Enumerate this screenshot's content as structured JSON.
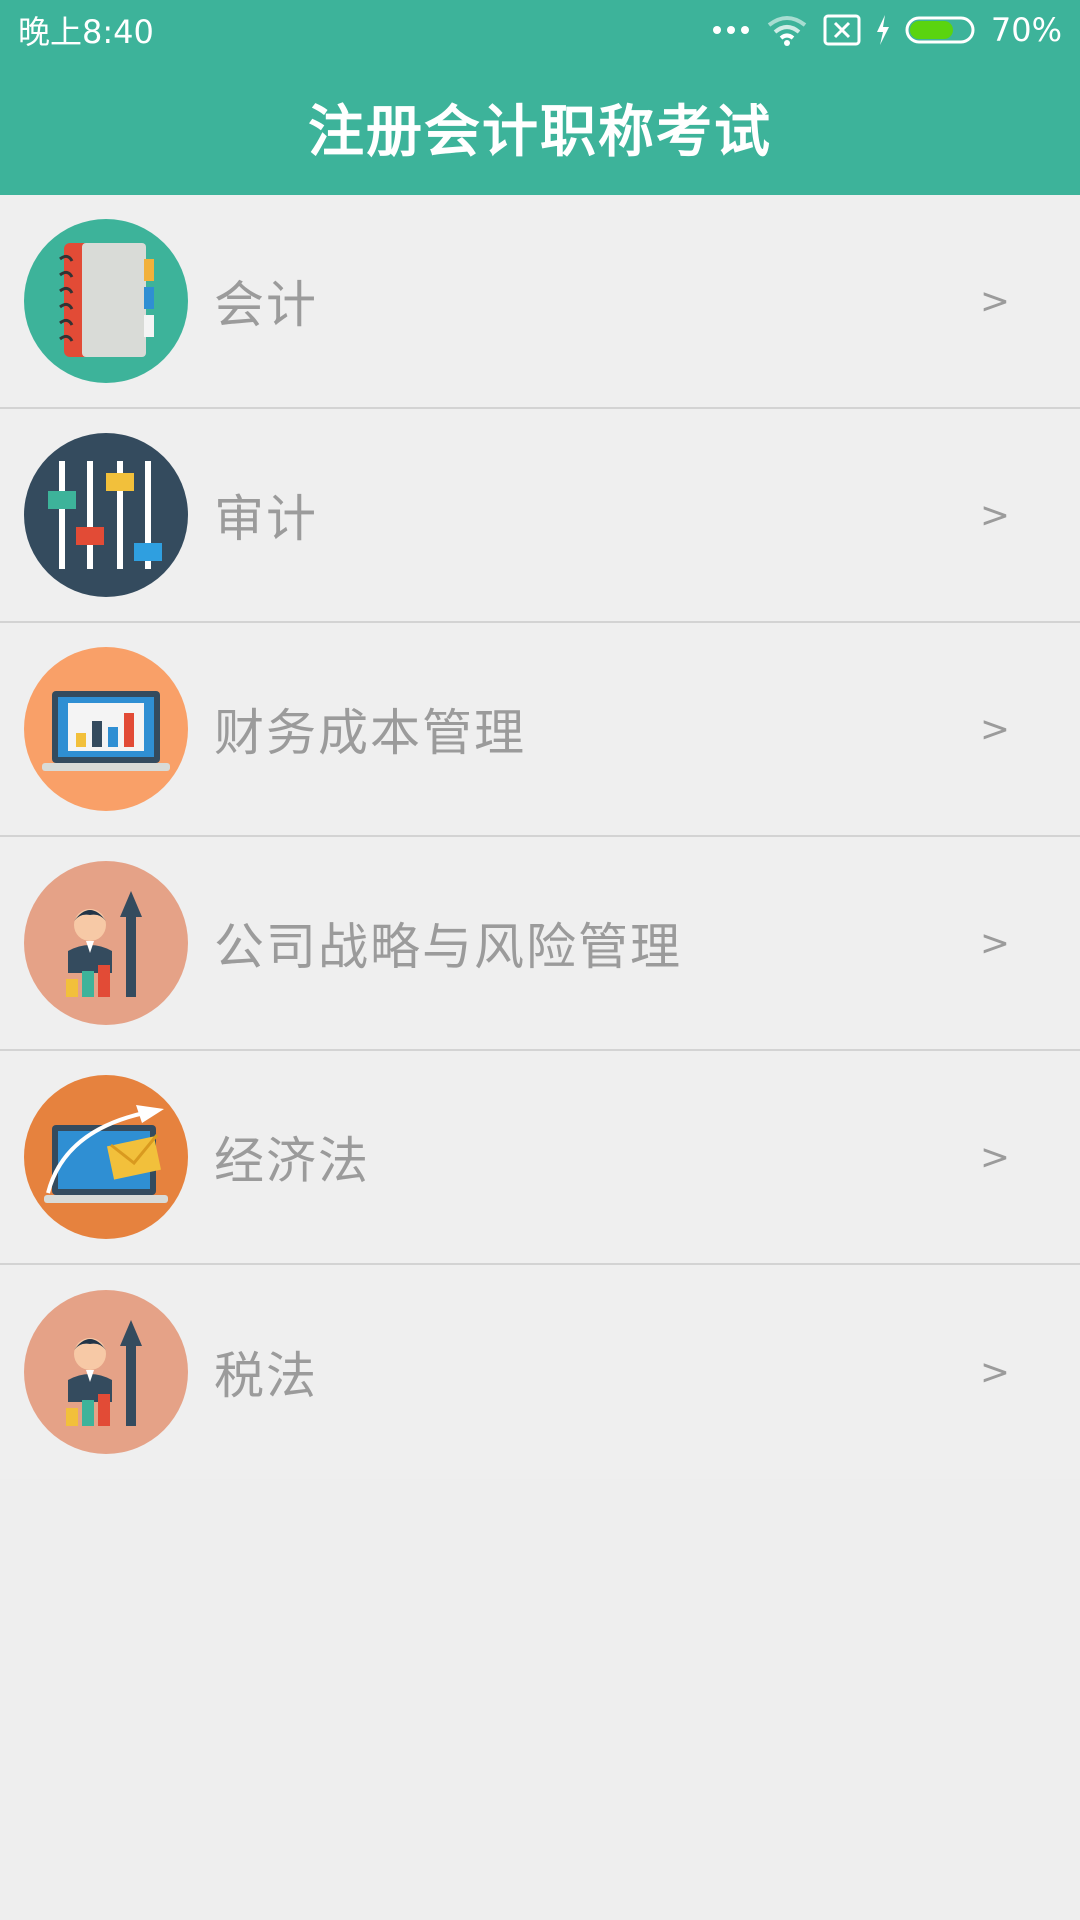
{
  "status_bar": {
    "time": "晚上8:40",
    "battery": "70%",
    "battery_level": 0.7,
    "icons": [
      "more-dots-icon",
      "wifi-icon",
      "sim-absent-icon",
      "charging-icon",
      "battery-icon"
    ]
  },
  "header": {
    "title": "注册会计职称考试",
    "color": "#3db39a"
  },
  "subjects": [
    {
      "label": "会计",
      "icon": "notebook-icon",
      "bg": "#3db39a",
      "chevron": ">"
    },
    {
      "label": "审计",
      "icon": "sliders-icon",
      "bg": "#344b5e",
      "chevron": ">"
    },
    {
      "label": "财务成本管理",
      "icon": "laptop-chart-icon",
      "bg": "#f9a068",
      "chevron": ">"
    },
    {
      "label": "公司战略与风险管理",
      "icon": "businessman-growth-icon",
      "bg": "#e5a287",
      "chevron": ">"
    },
    {
      "label": "经济法",
      "icon": "laptop-mail-icon",
      "bg": "#e6823e",
      "chevron": ">"
    },
    {
      "label": "税法",
      "icon": "businessman-growth-icon",
      "bg": "#e5a287",
      "chevron": ">"
    }
  ]
}
